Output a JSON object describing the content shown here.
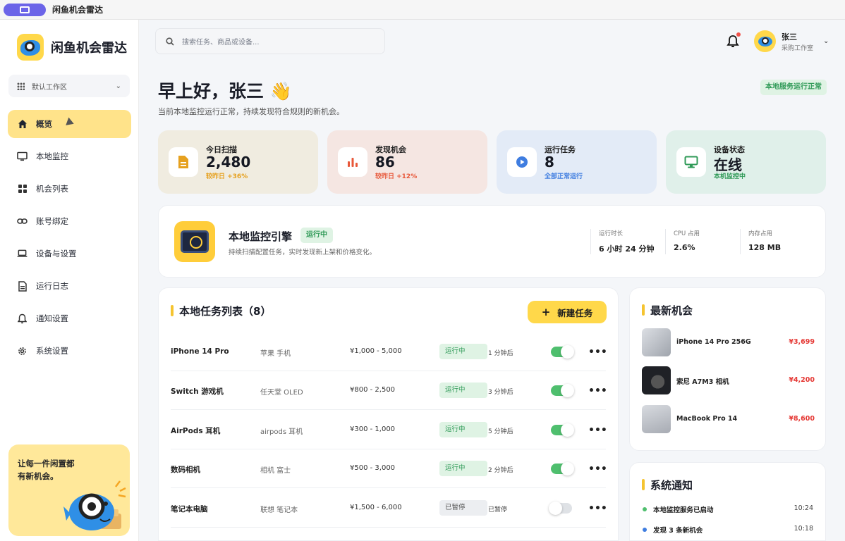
{
  "window": {
    "title": "闲鱼机会雷达"
  },
  "brand": {
    "name": "闲鱼机会雷达"
  },
  "workspace": {
    "label": "默认工作区"
  },
  "sidebar": {
    "items": [
      {
        "label": "概览",
        "icon": "home-icon",
        "active": true
      },
      {
        "label": "本地监控",
        "icon": "monitor-icon"
      },
      {
        "label": "机会列表",
        "icon": "grid-icon"
      },
      {
        "label": "账号绑定",
        "icon": "link-icon"
      },
      {
        "label": "设备与设置",
        "icon": "laptop-icon"
      },
      {
        "label": "运行日志",
        "icon": "document-icon"
      },
      {
        "label": "通知设置",
        "icon": "bell-icon"
      },
      {
        "label": "系统设置",
        "icon": "gear-icon"
      }
    ],
    "promo": "让每一件闲置都有新机会。"
  },
  "header": {
    "search_placeholder": "搜索任务、商品或设备...",
    "user_name": "张三",
    "user_role": "采购工作室"
  },
  "greeting": {
    "title": "早上好，张三 👋",
    "subtitle": "当前本地监控运行正常，持续发现符合规则的新机会。",
    "service_status": "本地服务运行正常"
  },
  "stats": [
    {
      "label": "今日扫描",
      "value": "2,480",
      "sub": "较昨日 +36%",
      "icon": "document-icon",
      "bg": "#f0ece0",
      "accent": "#e6a11f"
    },
    {
      "label": "发现机会",
      "value": "86",
      "sub": "较昨日 +12%",
      "icon": "bar-chart-icon",
      "bg": "#f5e6e2",
      "accent": "#e8583a"
    },
    {
      "label": "运行任务",
      "value": "8",
      "sub": "全部正常运行",
      "icon": "play-icon",
      "bg": "#e3ebf7",
      "accent": "#3f7de0"
    },
    {
      "label": "设备状态",
      "value": "在线",
      "sub": "本机监控中",
      "icon": "monitor-icon",
      "bg": "#e0f0ea",
      "accent": "#2f9a57"
    }
  ],
  "engine": {
    "title": "本地监控引擎",
    "status": "运行中",
    "desc": "持续扫描配置任务，实时发现新上架和价格变化。",
    "metrics": [
      {
        "label": "运行时长",
        "value": "6 小时 24 分钟"
      },
      {
        "label": "CPU 占用",
        "value": "2.6%"
      },
      {
        "label": "内存占用",
        "value": "128 MB"
      }
    ]
  },
  "tasks": {
    "title": "本地任务列表（8）",
    "new_label": "新建任务",
    "rows": [
      {
        "name": "iPhone 14 Pro",
        "keywords": "苹果 手机",
        "price": "¥1,000 - 5,000",
        "status": "运行中",
        "next": "1 分钟后",
        "on": true
      },
      {
        "name": "Switch 游戏机",
        "keywords": "任天堂 OLED",
        "price": "¥800 - 2,500",
        "status": "运行中",
        "next": "3 分钟后",
        "on": true
      },
      {
        "name": "AirPods 耳机",
        "keywords": "airpods 耳机",
        "price": "¥300 - 1,000",
        "status": "运行中",
        "next": "5 分钟后",
        "on": true
      },
      {
        "name": "数码相机",
        "keywords": "相机 富士",
        "price": "¥500 - 3,000",
        "status": "运行中",
        "next": "2 分钟后",
        "on": true
      },
      {
        "name": "笔记本电脑",
        "keywords": "联想 笔记本",
        "price": "¥1,500 - 6,000",
        "status": "已暂停",
        "next": "已暂停",
        "on": false
      }
    ]
  },
  "opportunities": {
    "title": "最新机会",
    "items": [
      {
        "name": "iPhone 14 Pro 256G",
        "price": "¥3,699",
        "thumb": "#c9ccd2"
      },
      {
        "name": "索尼 A7M3 相机",
        "price": "¥4,200",
        "thumb": "#2b2d33"
      },
      {
        "name": "MacBook Pro 14",
        "price": "¥8,600",
        "thumb": "#b9bdc4"
      }
    ]
  },
  "notifications": {
    "title": "系统通知",
    "items": [
      {
        "text": "本地监控服务已启动",
        "time": "10:24",
        "color": "#4fbf6e"
      },
      {
        "text": "发现 3 条新机会",
        "time": "10:18",
        "color": "#3f7de0"
      }
    ]
  }
}
